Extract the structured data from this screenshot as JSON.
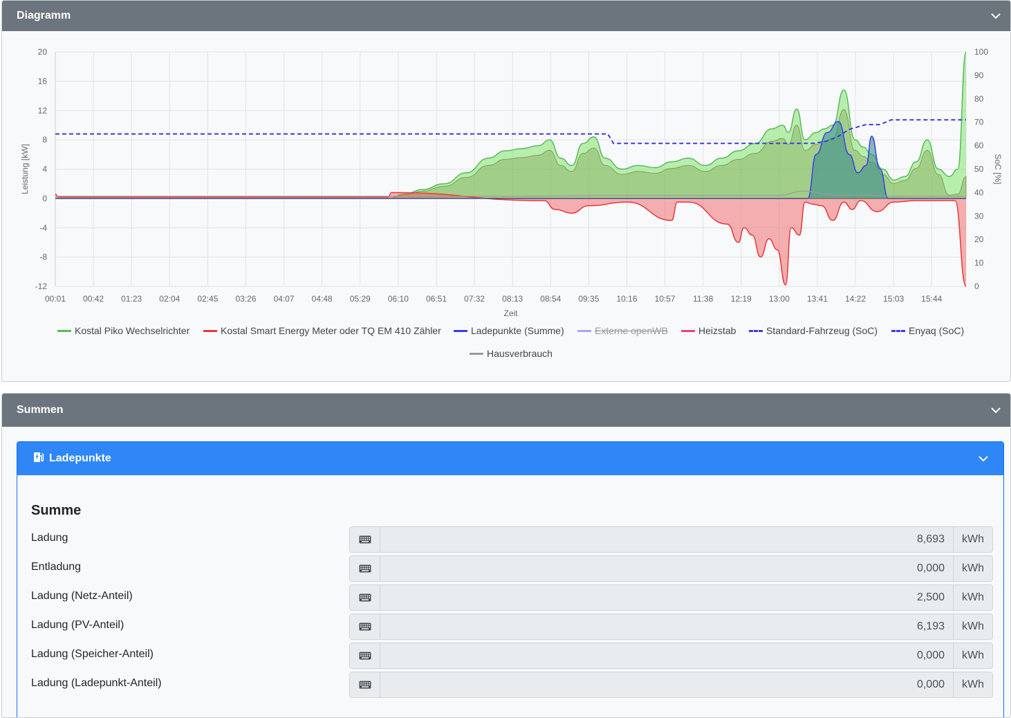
{
  "diagram": {
    "title": "Diagramm",
    "legend": [
      {
        "label": "Kostal Piko Wechselrichter",
        "color": "#5cb85c",
        "style": "solid",
        "hidden": false
      },
      {
        "label": "Kostal Smart Energy Meter oder TQ EM 410 Zähler",
        "color": "#e8373a",
        "style": "solid",
        "hidden": false
      },
      {
        "label": "Ladepunkte (Summe)",
        "color": "#3b3bf0",
        "style": "solid",
        "hidden": false
      },
      {
        "label": "Externe openWB",
        "color": "#a8a8f0",
        "style": "solid",
        "hidden": true
      },
      {
        "label": "Heizstab",
        "color": "#e83e8c",
        "style": "solid",
        "hidden": false
      },
      {
        "label": "Standard-Fahrzeug (SoC)",
        "color": "#3b3bdb",
        "style": "dashed",
        "hidden": false
      },
      {
        "label": "Enyaq (SoC)",
        "color": "#3b3bdb",
        "style": "dashed",
        "hidden": false
      },
      {
        "label": "Hausverbrauch",
        "color": "#9a9a9a",
        "style": "solid",
        "hidden": false
      }
    ]
  },
  "chart_data": {
    "type": "area",
    "xlabel": "Zeit",
    "ylabel_left": "Leistung [kW]",
    "ylabel_right": "SoC [%]",
    "ylim_left": [
      -12,
      20
    ],
    "ylim_right": [
      0,
      100
    ],
    "yticks_left": [
      "20",
      "16",
      "12",
      "8",
      "4",
      "0",
      "-4",
      "-8",
      "-12"
    ],
    "yticks_right": [
      "100",
      "90",
      "80",
      "70",
      "60",
      "50",
      "40",
      "30",
      "20",
      "10",
      "0"
    ],
    "x_ticks": [
      "00:01",
      "00:42",
      "01:23",
      "02:04",
      "02:45",
      "03:26",
      "04:07",
      "04:48",
      "05:29",
      "06:10",
      "06:51",
      "07:32",
      "08:13",
      "08:54",
      "09:35",
      "10:16",
      "10:57",
      "11:38",
      "12:19",
      "13:00",
      "13:41",
      "14:22",
      "15:03",
      "15:44"
    ],
    "grid": true,
    "legend_position": "bottom",
    "series": [
      {
        "name": "Kostal Piko Wechselrichter",
        "axis": "left",
        "t": [
          0,
          6.0,
          6.3,
          6.6,
          7.0,
          7.4,
          7.8,
          8.1,
          8.4,
          8.7,
          8.9,
          9.1,
          9.3,
          9.5,
          9.7,
          9.9,
          10.2,
          10.5,
          10.8,
          11.1,
          11.4,
          11.7,
          12.0,
          12.3,
          12.6,
          12.9,
          13.1,
          13.2,
          13.35,
          13.5,
          13.7,
          13.85,
          14.0,
          14.2,
          14.4,
          14.55,
          14.7,
          14.9,
          15.1,
          15.3,
          15.5,
          15.7,
          15.9,
          16.1,
          16.25,
          16.4
        ],
        "values": [
          0,
          0,
          0.6,
          1.2,
          2.0,
          3.5,
          5.5,
          6.5,
          6.8,
          7.2,
          8.0,
          5.5,
          4.5,
          7.5,
          8.4,
          5.5,
          4.0,
          4.5,
          4.2,
          5.0,
          5.5,
          4.5,
          5.5,
          6.5,
          7.5,
          9.5,
          10.0,
          9.0,
          12.2,
          8.0,
          9.0,
          9.5,
          10.0,
          14.8,
          8.0,
          7.0,
          6.0,
          4.0,
          2.5,
          3.0,
          5.0,
          8.0,
          4.0,
          3.0,
          4.0,
          20.0
        ]
      },
      {
        "name": "Kostal Smart Energy Meter oder TQ EM 410 Zähler",
        "axis": "left",
        "t": [
          0,
          0.05,
          0.3,
          6.0,
          6.05,
          8.8,
          9.0,
          9.3,
          9.6,
          10.3,
          11.1,
          11.2,
          11.4,
          12.1,
          12.3,
          12.4,
          12.55,
          12.7,
          12.85,
          13.0,
          13.15,
          13.25,
          13.4,
          13.5,
          13.65,
          13.8,
          14.0,
          14.2,
          14.35,
          14.5,
          14.8,
          15.1,
          15.5,
          16.2,
          16.4
        ],
        "values": [
          0.6,
          0.2,
          0.2,
          0.2,
          0.8,
          -0.3,
          -1.5,
          -2.0,
          -1.0,
          -0.5,
          -3.0,
          -0.5,
          -0.5,
          -3.5,
          -6.0,
          -4.0,
          -5.0,
          -8.0,
          -5.5,
          -7.0,
          -11.8,
          -4.0,
          -5.0,
          -0.5,
          -0.8,
          -1.0,
          -3.0,
          -0.5,
          -1.5,
          -0.3,
          -1.8,
          -0.5,
          -0.3,
          -0.3,
          -12.0
        ]
      },
      {
        "name": "Hausverbrauch",
        "axis": "left",
        "t": [
          0,
          6.0,
          8.0,
          10.0,
          12.0,
          13.0,
          13.5,
          14.0,
          14.5,
          15.0,
          15.5,
          16.4
        ],
        "values": [
          0.3,
          0.3,
          0.3,
          0.4,
          0.4,
          0.4,
          1.0,
          0.5,
          0.5,
          0.3,
          0.3,
          0.3
        ]
      },
      {
        "name": "Ladepunkte (Summe)",
        "axis": "left",
        "t": [
          0,
          13.55,
          13.7,
          13.9,
          14.1,
          14.3,
          14.45,
          14.6,
          14.7,
          14.85,
          15.0,
          16.4
        ],
        "values": [
          0,
          0,
          6.0,
          9.0,
          10.5,
          6.0,
          3.5,
          4.5,
          8.5,
          4.0,
          0,
          0
        ]
      },
      {
        "name": "Enyaq (SoC)",
        "axis": "right",
        "t": [
          0,
          9.95,
          10.05,
          13.65,
          13.9,
          14.1,
          14.3,
          14.6,
          14.85,
          15.05,
          16.4
        ],
        "values": [
          65,
          65,
          61,
          61,
          62,
          64,
          67,
          69,
          69,
          71,
          71
        ]
      }
    ]
  },
  "summen": {
    "title": "Summen",
    "ladepunkte": {
      "title": "Ladepunkte",
      "section_title": "Summe",
      "rows": [
        {
          "label": "Ladung",
          "value": "8,693",
          "unit": "kWh"
        },
        {
          "label": "Entladung",
          "value": "0,000",
          "unit": "kWh"
        },
        {
          "label": "Ladung (Netz-Anteil)",
          "value": "2,500",
          "unit": "kWh"
        },
        {
          "label": "Ladung (PV-Anteil)",
          "value": "6,193",
          "unit": "kWh"
        },
        {
          "label": "Ladung (Speicher-Anteil)",
          "value": "0,000",
          "unit": "kWh"
        },
        {
          "label": "Ladung (Ladepunkt-Anteil)",
          "value": "0,000",
          "unit": "kWh"
        }
      ]
    }
  }
}
